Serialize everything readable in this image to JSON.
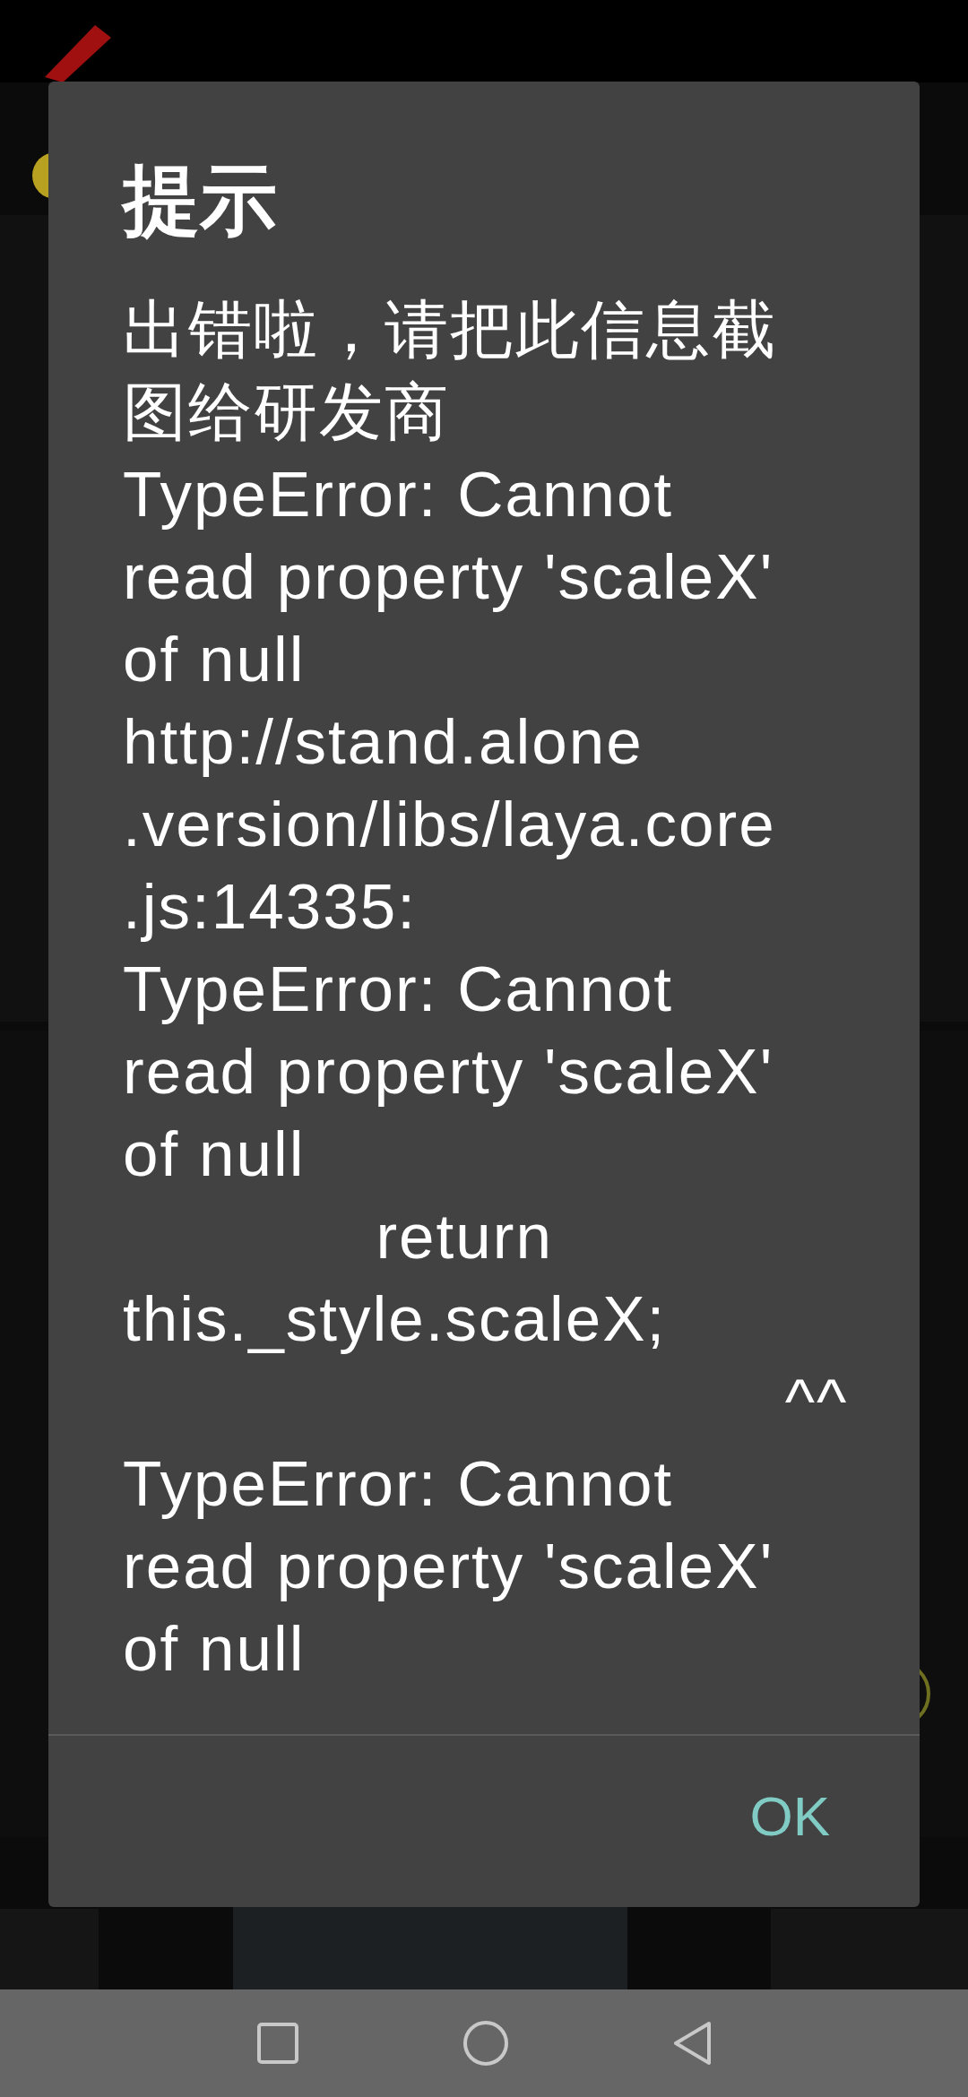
{
  "dialog": {
    "title": "提示",
    "message_lines": [
      "出错啦，请把此信息截",
      "图给研发商",
      "TypeError: Cannot",
      "read property 'scaleX'",
      "of null",
      "http://stand.alone",
      ".version/libs/laya.core",
      ".js:14335:",
      "TypeError: Cannot",
      "read property 'scaleX'",
      "of null",
      "             return",
      "this._style.scaleX;",
      "                                  ^^",
      "TypeError: Cannot",
      "read property 'scaleX'",
      "of null"
    ],
    "buttons": [
      "OK"
    ]
  }
}
